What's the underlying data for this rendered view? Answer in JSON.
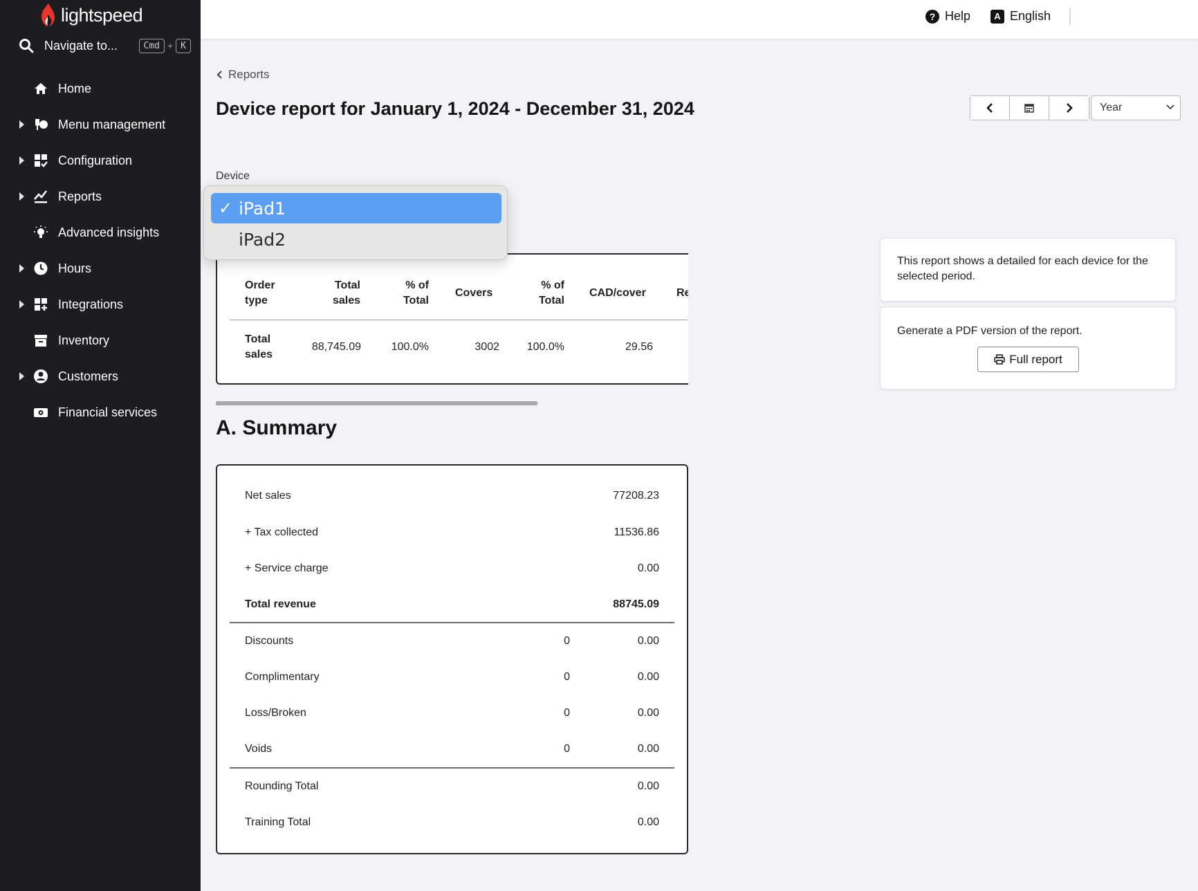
{
  "brand": {
    "name": "lightspeed",
    "accent": "#e8342b"
  },
  "sidebar": {
    "search_label": "Navigate to...",
    "shortcut": {
      "key1": "Cmd",
      "plus": "+",
      "key2": "K"
    },
    "items": [
      {
        "label": "Home",
        "icon": "home-icon",
        "expandable": false
      },
      {
        "label": "Menu management",
        "icon": "menu-management-icon",
        "expandable": true
      },
      {
        "label": "Configuration",
        "icon": "configuration-icon",
        "expandable": true
      },
      {
        "label": "Reports",
        "icon": "reports-icon",
        "expandable": true
      },
      {
        "label": "Advanced insights",
        "icon": "lightbulb-icon",
        "expandable": false
      },
      {
        "label": "Hours",
        "icon": "clock-icon",
        "expandable": true
      },
      {
        "label": "Integrations",
        "icon": "integrations-icon",
        "expandable": true
      },
      {
        "label": "Inventory",
        "icon": "inventory-icon",
        "expandable": false
      },
      {
        "label": "Customers",
        "icon": "customer-icon",
        "expandable": true
      },
      {
        "label": "Financial services",
        "icon": "cash-icon",
        "expandable": false
      }
    ]
  },
  "topbar": {
    "help": "Help",
    "language": "English"
  },
  "breadcrumb": "Reports",
  "page_title": "Device report for January 1, 2024 - December 31, 2024",
  "period": {
    "selected": "Year"
  },
  "device": {
    "label": "Device",
    "options": [
      "iPad1",
      "iPad2"
    ],
    "selected": "iPad1"
  },
  "device_table": {
    "headers": [
      "Order type",
      "Total sales",
      "% of Total",
      "Covers",
      "% of Total",
      "CAD/cover",
      "Re"
    ],
    "row": [
      "Total sales",
      "88,745.09",
      "100.0%",
      "3002",
      "100.0%",
      "29.56",
      ""
    ]
  },
  "summary": {
    "title": "A. Summary",
    "rows": [
      {
        "label": "Net sales",
        "count": "",
        "value": "77208.23",
        "bold": false
      },
      {
        "label": "+ Tax collected",
        "count": "",
        "value": "11536.86",
        "bold": false
      },
      {
        "label": "+ Service charge",
        "count": "",
        "value": "0.00",
        "bold": false
      },
      {
        "label": "Total revenue",
        "count": "",
        "value": "88745.09",
        "bold": true
      },
      {
        "label": "Discounts",
        "count": "0",
        "value": "0.00",
        "bold": false
      },
      {
        "label": "Complimentary",
        "count": "0",
        "value": "0.00",
        "bold": false
      },
      {
        "label": "Loss/Broken",
        "count": "0",
        "value": "0.00",
        "bold": false
      },
      {
        "label": "Voids",
        "count": "0",
        "value": "0.00",
        "bold": false
      },
      {
        "label": "Rounding Total",
        "count": "",
        "value": "0.00",
        "bold": false
      },
      {
        "label": "Training Total",
        "count": "",
        "value": "0.00",
        "bold": false
      }
    ]
  },
  "info": {
    "description": "This report shows a detailed for each device for the selected period.",
    "pdf_text": "Generate a PDF version of the report.",
    "pdf_button": "Full report"
  }
}
